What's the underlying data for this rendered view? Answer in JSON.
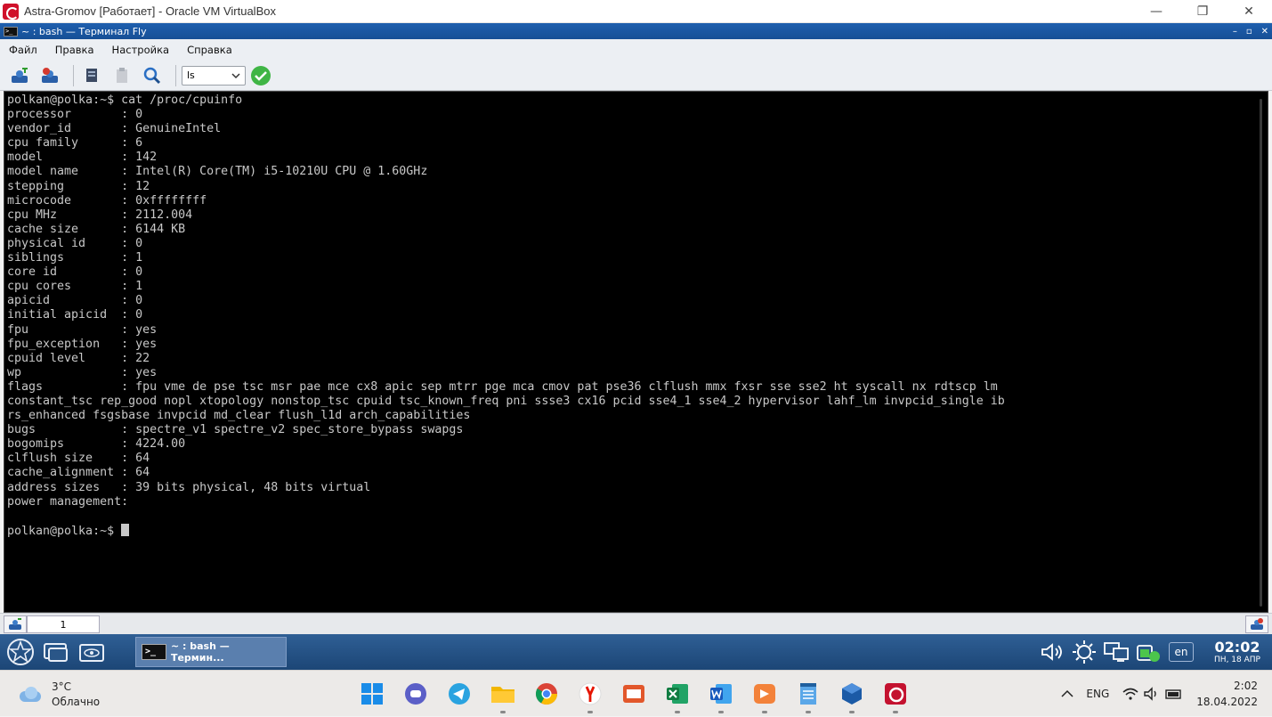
{
  "host": {
    "title": "Astra-Gromov [Работает] - Oracle VM VirtualBox",
    "minimize": "—",
    "restore": "❐",
    "close": "✕"
  },
  "fly": {
    "title": "~ : bash — Терминал Fly",
    "icon_text": ">_",
    "min": "–",
    "max": "▫",
    "close": "✕"
  },
  "menu": [
    "Файл",
    "Правка",
    "Настройка",
    "Справка"
  ],
  "toolbar": {
    "command_value": "ls"
  },
  "terminal": {
    "lines": [
      "polkan@polka:~$ cat /proc/cpuinfo",
      "processor       : 0",
      "vendor_id       : GenuineIntel",
      "cpu family      : 6",
      "model           : 142",
      "model name      : Intel(R) Core(TM) i5-10210U CPU @ 1.60GHz",
      "stepping        : 12",
      "microcode       : 0xffffffff",
      "cpu MHz         : 2112.004",
      "cache size      : 6144 KB",
      "physical id     : 0",
      "siblings        : 1",
      "core id         : 0",
      "cpu cores       : 1",
      "apicid          : 0",
      "initial apicid  : 0",
      "fpu             : yes",
      "fpu_exception   : yes",
      "cpuid level     : 22",
      "wp              : yes",
      "flags           : fpu vme de pse tsc msr pae mce cx8 apic sep mtrr pge mca cmov pat pse36 clflush mmx fxsr sse sse2 ht syscall nx rdtscp lm",
      "constant_tsc rep_good nopl xtopology nonstop_tsc cpuid tsc_known_freq pni ssse3 cx16 pcid sse4_1 sse4_2 hypervisor lahf_lm invpcid_single ib",
      "rs_enhanced fsgsbase invpcid md_clear flush_l1d arch_capabilities",
      "bugs            : spectre_v1 spectre_v2 spec_store_bypass swapgs",
      "bogomips        : 4224.00",
      "clflush size    : 64",
      "cache_alignment : 64",
      "address sizes   : 39 bits physical, 48 bits virtual",
      "power management:",
      ""
    ],
    "prompt": "polkan@polka:~$ "
  },
  "tabs": {
    "active_label": "1"
  },
  "flypanel": {
    "task_label": "~ : bash — Термин...",
    "task_icon_text": ">_",
    "lang": "en",
    "time": "02:02",
    "date": "ПН, 18 АПР"
  },
  "windows": {
    "weather_temp": "3°C",
    "weather_desc": "Облачно",
    "lang": "ENG",
    "time": "2:02",
    "date": "18.04.2022"
  }
}
